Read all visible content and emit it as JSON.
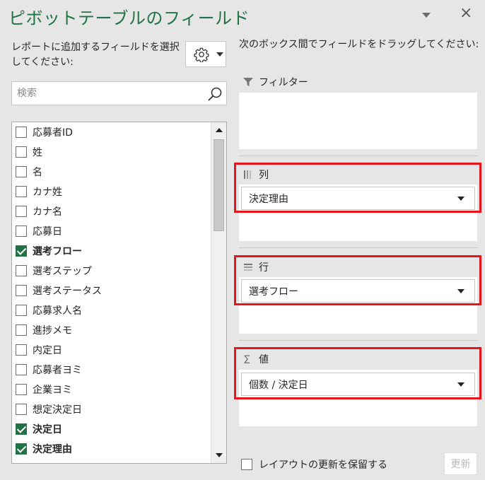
{
  "panel": {
    "title": "ピボットテーブルのフィールド",
    "close_glyph": "×"
  },
  "left": {
    "instruction": "レポートに追加するフィールドを選択してください:",
    "search_placeholder": "検索",
    "fields": [
      {
        "label": "応募者ID",
        "checked": false
      },
      {
        "label": "姓",
        "checked": false
      },
      {
        "label": "名",
        "checked": false
      },
      {
        "label": "カナ姓",
        "checked": false
      },
      {
        "label": "カナ名",
        "checked": false
      },
      {
        "label": "応募日",
        "checked": false
      },
      {
        "label": "選考フロー",
        "checked": true
      },
      {
        "label": "選考ステップ",
        "checked": false
      },
      {
        "label": "選考ステータス",
        "checked": false
      },
      {
        "label": "応募求人名",
        "checked": false
      },
      {
        "label": "進捗メモ",
        "checked": false
      },
      {
        "label": "内定日",
        "checked": false
      },
      {
        "label": "応募者ヨミ",
        "checked": false
      },
      {
        "label": "企業ヨミ",
        "checked": false
      },
      {
        "label": "想定決定日",
        "checked": false
      },
      {
        "label": "決定日",
        "checked": true
      },
      {
        "label": "決定理由",
        "checked": true
      }
    ]
  },
  "right": {
    "instruction": "次のボックス間でフィールドをドラッグしてください:",
    "filter_label": "フィルター",
    "columns_label": "列",
    "columns_field": "決定理由",
    "rows_label": "行",
    "rows_field": "選考フロー",
    "values_label": "値",
    "values_field": "個数 / 決定日",
    "sigma_glyph": "Σ"
  },
  "footer": {
    "defer_label": "レイアウトの更新を保留する",
    "update_label": "更新"
  },
  "colors": {
    "accent": "#217346",
    "highlight": "#e8141b"
  }
}
